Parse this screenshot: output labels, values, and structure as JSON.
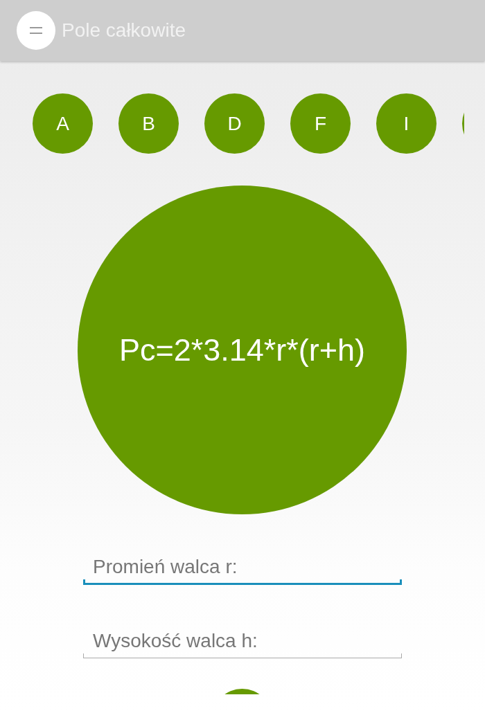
{
  "app_bar": {
    "title": "Pole całkowite"
  },
  "letters": [
    {
      "label": "A"
    },
    {
      "label": "B"
    },
    {
      "label": "D"
    },
    {
      "label": "F"
    },
    {
      "label": "I"
    }
  ],
  "formula": "Pc=2*3.14*r*(r+h)",
  "fields": [
    {
      "placeholder": "Promień walca r:",
      "focused": true
    },
    {
      "placeholder": "Wysokość walca h:",
      "focused": false
    }
  ]
}
